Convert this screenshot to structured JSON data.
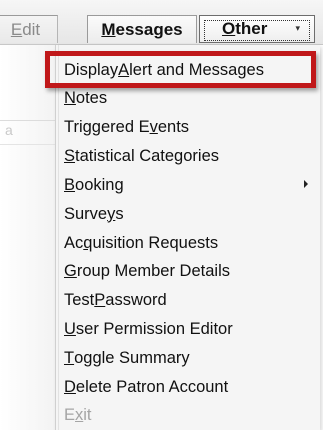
{
  "menubar": {
    "tabs": [
      {
        "label_pre": "",
        "label_ul": "E",
        "label_post": "dit",
        "display": "Edit"
      },
      {
        "label_pre": "",
        "label_ul": "M",
        "label_post": "essages",
        "display": "Messages"
      },
      {
        "label_pre": "",
        "label_ul": "O",
        "label_post": "ther",
        "display": "Other"
      }
    ],
    "dropdown_icon": "chevron-down-icon"
  },
  "menu": {
    "items": [
      {
        "pre": "Display ",
        "ul": "A",
        "post": "lert and Messages",
        "state": "highlighted"
      },
      {
        "pre": "",
        "ul": "N",
        "post": "otes",
        "state": "normal"
      },
      {
        "pre": "Triggered E",
        "ul": "v",
        "post": "ents",
        "state": "normal"
      },
      {
        "pre": "",
        "ul": "S",
        "post": "tatistical Categories",
        "state": "normal"
      },
      {
        "pre": "",
        "ul": "B",
        "post": "ooking",
        "state": "normal",
        "submenu": true
      },
      {
        "pre": "Surve",
        "ul": "y",
        "post": "s",
        "state": "normal"
      },
      {
        "pre": "Ac",
        "ul": "q",
        "post": "uisition Requests",
        "state": "normal"
      },
      {
        "pre": "",
        "ul": "G",
        "post": "roup Member Details",
        "state": "normal"
      },
      {
        "pre": "Test ",
        "ul": "P",
        "post": "assword",
        "state": "normal"
      },
      {
        "pre": "",
        "ul": "U",
        "post": "ser Permission Editor",
        "state": "normal"
      },
      {
        "pre": "",
        "ul": "T",
        "post": "oggle Summary",
        "state": "normal"
      },
      {
        "pre": "",
        "ul": "D",
        "post": "elete Patron Account",
        "state": "normal"
      },
      {
        "pre": "E",
        "ul": "x",
        "post": "it",
        "state": "disabled"
      }
    ]
  },
  "colors": {
    "highlight_border": "#c0181a",
    "menu_background": "#f5f5f5",
    "disabled_text": "#a5a5a5"
  }
}
